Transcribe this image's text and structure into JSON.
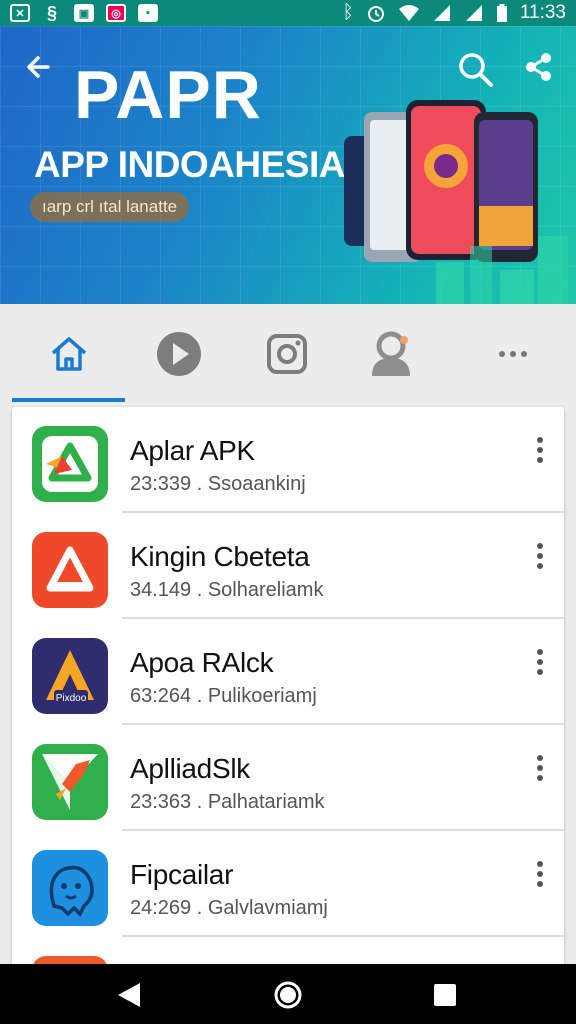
{
  "status_bar": {
    "time": "11:33",
    "left_icons": [
      "app-notification-icon",
      "sync-icon",
      "gallery-icon",
      "camera-icon",
      "square-icon"
    ],
    "right_icons": [
      "bluetooth-icon",
      "alarm-icon",
      "wifi-icon",
      "signal-icon",
      "signal-icon",
      "battery-icon"
    ]
  },
  "banner": {
    "title": "PAPR",
    "subtitle": "APP INDOAHESIA",
    "tagline": "ıarp crl ıtal lanatte",
    "colors": {
      "gradient_start": "#1f67c9",
      "gradient_end": "#1fc7a6",
      "tagline_bg": "#8c6e46"
    }
  },
  "tabs": {
    "items": [
      {
        "icon": "home-icon",
        "active": true
      },
      {
        "icon": "play-icon",
        "active": false
      },
      {
        "icon": "instagram-icon",
        "active": false
      },
      {
        "icon": "person-icon",
        "active": false
      },
      {
        "icon": "more-horizontal-icon",
        "active": false
      }
    ],
    "accent": "#1b7bd4"
  },
  "apps": [
    {
      "name": "Aplar APK",
      "meta": "23:339 . Ssoaankinj",
      "icon": "green-triangle-icon"
    },
    {
      "name": "Kingin Cbeteta",
      "meta": "34.149 . Solhareliamk",
      "icon": "red-triangle-icon"
    },
    {
      "name": "Apoa RAlck",
      "meta": "63:264 . Pulikoeriamj",
      "icon": "orange-a-icon"
    },
    {
      "name": "AplliadSlk",
      "meta": "23:363 . Palhatariamk",
      "icon": "paper-plane-icon"
    },
    {
      "name": "Fipcailar",
      "meta": "24:269 . Galvlavmiamj",
      "icon": "blue-face-icon"
    }
  ],
  "nav": {
    "icons": [
      "back-triangle-icon",
      "home-circle-icon",
      "recents-square-icon"
    ]
  }
}
